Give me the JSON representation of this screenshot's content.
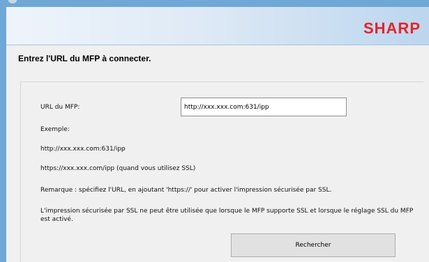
{
  "brand": {
    "logo_text": "SHARP",
    "logo_color": "#e8232a"
  },
  "heading": "Entrez l'URL du MFP à connecter.",
  "form": {
    "url_label": "URL du MFP:",
    "url_value": "http://xxx.xxx.com:631/ipp",
    "example_label": "Exemple:",
    "example_http": "http://xxx.xxx.com:631/ipp",
    "example_https": "https://xxx.xxx.com/ipp (quand vous utilisez SSL)",
    "remark": "Remarque : spécifiez l'URL, en ajoutant 'https://' pour activer l'impression sécurisée par SSL.",
    "ssl_note": "L'impression sécurisée par SSL ne peut être utilisée que lorsque le MFP supporte SSL et lorsque le réglage SSL du MFP est activé.",
    "search_button": "Rechercher"
  }
}
